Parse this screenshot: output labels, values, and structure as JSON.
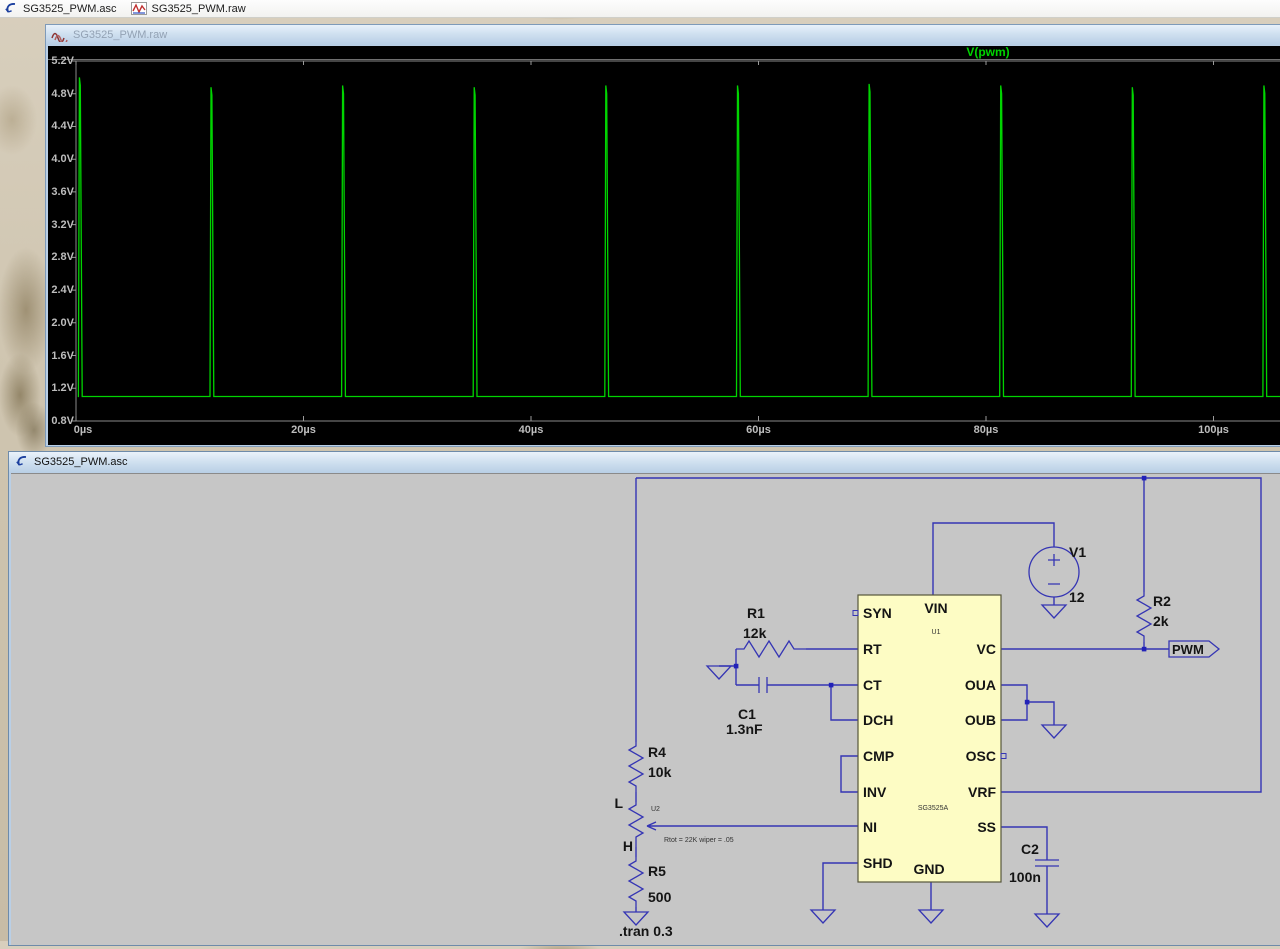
{
  "tab_bar": {
    "tabs": [
      {
        "label": "SG3525_PWM.asc",
        "icon": "schematic-icon"
      },
      {
        "label": "SG3525_PWM.raw",
        "icon": "waveform-icon"
      }
    ]
  },
  "wave_window": {
    "title": "SG3525_PWM.raw"
  },
  "chart_data": {
    "type": "line",
    "series_name": "V(pwm)",
    "series_color": "#00d400",
    "legend_position": "top",
    "grid": false,
    "x_unit": "µs",
    "x_range_us": [
      0,
      106
    ],
    "y_range_v": [
      0.8,
      5.2
    ],
    "baseline_v": 1.1,
    "period_us": 11.57,
    "pulses": [
      {
        "t_us": 0.3,
        "peak_v": 5.0
      },
      {
        "t_us": 11.87,
        "peak_v": 4.88
      },
      {
        "t_us": 23.44,
        "peak_v": 4.9
      },
      {
        "t_us": 35.01,
        "peak_v": 4.88
      },
      {
        "t_us": 46.58,
        "peak_v": 4.9
      },
      {
        "t_us": 58.15,
        "peak_v": 4.9
      },
      {
        "t_us": 69.72,
        "peak_v": 4.92
      },
      {
        "t_us": 81.29,
        "peak_v": 4.9
      },
      {
        "t_us": 92.86,
        "peak_v": 4.88
      },
      {
        "t_us": 104.43,
        "peak_v": 4.9
      }
    ],
    "y_ticks": [
      {
        "label": "5.2V",
        "v": 5.2
      },
      {
        "label": "4.8V",
        "v": 4.8
      },
      {
        "label": "4.4V",
        "v": 4.4
      },
      {
        "label": "4.0V",
        "v": 4.0
      },
      {
        "label": "3.6V",
        "v": 3.6
      },
      {
        "label": "3.2V",
        "v": 3.2
      },
      {
        "label": "2.8V",
        "v": 2.8
      },
      {
        "label": "2.4V",
        "v": 2.4
      },
      {
        "label": "2.0V",
        "v": 2.0
      },
      {
        "label": "1.6V",
        "v": 1.6
      },
      {
        "label": "1.2V",
        "v": 1.2
      },
      {
        "label": "0.8V",
        "v": 0.8
      }
    ],
    "x_ticks": [
      {
        "label": "0µs",
        "us": 0
      },
      {
        "label": "20µs",
        "us": 20
      },
      {
        "label": "40µs",
        "us": 40
      },
      {
        "label": "60µs",
        "us": 60
      },
      {
        "label": "80µs",
        "us": 80
      },
      {
        "label": "100µs",
        "us": 100
      }
    ]
  },
  "schematic": {
    "title": "SG3525_PWM.asc",
    "directive": ".tran 0.3",
    "net_label": "PWM",
    "ic": {
      "refdes": "U1",
      "part": "SG3525A",
      "pin_top": "VIN",
      "pin_bottom": "GND",
      "pins_left": [
        "SYN",
        "RT",
        "CT",
        "DCH",
        "CMP",
        "INV",
        "NI",
        "SHD"
      ],
      "pins_right": [
        "VC",
        "OUA",
        "OUB",
        "OSC",
        "VRF",
        "SS"
      ]
    },
    "r1": {
      "ref": "R1",
      "value": "12k"
    },
    "c1": {
      "ref": "C1",
      "value": "1.3nF"
    },
    "r2": {
      "ref": "R2",
      "value": "2k"
    },
    "r4": {
      "ref": "R4",
      "value": "10k"
    },
    "r5": {
      "ref": "R5",
      "value": "500"
    },
    "v1": {
      "ref": "V1",
      "value": "12"
    },
    "c2": {
      "ref": "C2",
      "value": "100n"
    },
    "u2": {
      "ref": "U2",
      "note": "Rtot = 22K wiper = .05",
      "top_label": "L",
      "bottom_label": "H"
    }
  }
}
